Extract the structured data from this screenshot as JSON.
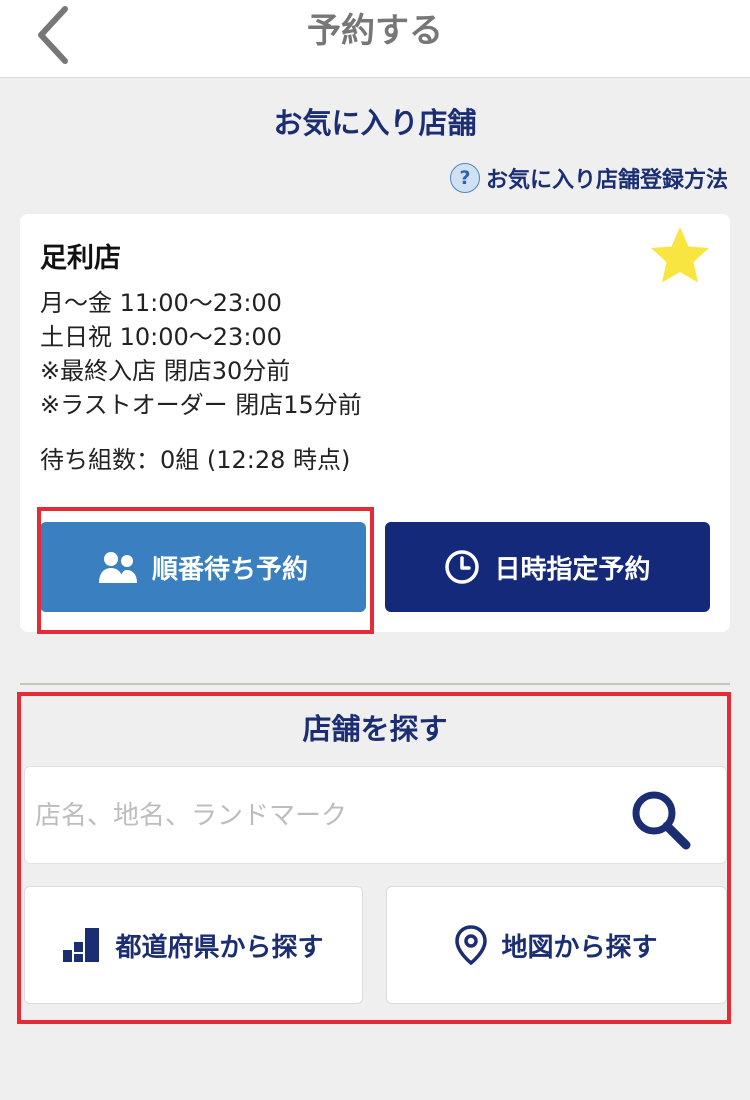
{
  "header": {
    "title": "予約する",
    "back_icon": "chevron-left-icon"
  },
  "favorites": {
    "title": "お気に入り店舗",
    "help_link": "お気に入り店舗登録方法",
    "help_icon": "question-circle-icon"
  },
  "store": {
    "name": "足利店",
    "favorite_icon": "star-icon",
    "favorite_color": "#f9e540",
    "hours": [
      "月～金 11:00～23:00",
      "土日祝 10:00～23:00",
      "※最終入店 閉店30分前",
      "※ラストオーダー 閉店15分前"
    ],
    "wait_status": "待ち組数：0組  (12:28 時点)",
    "queue_button": {
      "label": "順番待ち予約",
      "icon": "people-icon",
      "color": "#3a80c0"
    },
    "datetime_button": {
      "label": "日時指定予約",
      "icon": "clock-icon",
      "color": "#15297a"
    }
  },
  "search": {
    "title": "店舗を探す",
    "placeholder": "店名、地名、ランドマーク",
    "search_icon": "search-icon",
    "prefecture_button": {
      "label": "都道府県から探す",
      "icon": "bar-steps-icon"
    },
    "map_button": {
      "label": "地図から探す",
      "icon": "map-pin-icon"
    }
  },
  "colors": {
    "accent": "#1b2e73",
    "highlight": "#e52b35",
    "background": "#efefef"
  }
}
